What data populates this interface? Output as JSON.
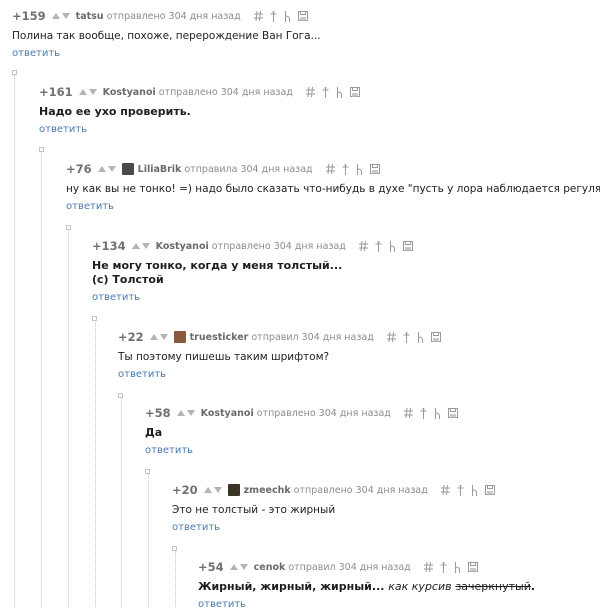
{
  "comments": [
    {
      "rating": "+159",
      "author": "tatsu",
      "meta": "отправлено 304 дня назад",
      "body": "Полина так вообще, похоже, перерождение Ван Гога...",
      "bold": false,
      "avatar": null,
      "reply": "ответить"
    },
    {
      "rating": "+161",
      "author": "Kostyanoi",
      "meta": "отправлено 304 дня назад",
      "body": "Надо ее ухо проверить.",
      "bold": true,
      "avatar": null,
      "reply": "ответить"
    },
    {
      "rating": "+76",
      "author": "LiliaBrik",
      "meta": "отправила 304 дня назад",
      "body": "ну как вы не тонко! =) надо было сказать что-нибудь в духе \"пусть у лора наблюдается регулярно\"",
      "bold": false,
      "avatar": "#4a4a4a",
      "reply": "ответить"
    },
    {
      "rating": "+134",
      "author": "Kostyanoi",
      "meta": "отправлено 304 дня назад",
      "body_lines": [
        "Не могу тонко, когда у меня толстый...",
        "(с) Толстой"
      ],
      "bold": true,
      "avatar": null,
      "reply": "ответить"
    },
    {
      "rating": "+22",
      "author": "truesticker",
      "meta": "отправил 304 дня назад",
      "body": "Ты поэтому пишешь таким шрифтом?",
      "bold": false,
      "avatar": "#8a5a3c",
      "reply": "ответить"
    },
    {
      "rating": "+58",
      "author": "Kostyanoi",
      "meta": "отправлено 304 дня назад",
      "body": "Да",
      "bold": true,
      "avatar": null,
      "reply": "ответить"
    },
    {
      "rating": "+20",
      "author": "zmeechk",
      "meta": "отправлено 304 дня назад",
      "body": "Это не толстый - это жирный",
      "bold": false,
      "avatar": "#3a3424",
      "reply": "ответить"
    },
    {
      "rating": "+54",
      "author": "cenok",
      "meta": "отправил 304 дня назад",
      "body_parts": {
        "bold": "Жирный, жирный, жирный...",
        "italic": "как курсив",
        "strike": "зачеркнутый",
        "end": "."
      },
      "bold": true,
      "avatar": null,
      "reply": "ответить"
    }
  ],
  "header_icons": [
    "hash-icon",
    "pin-icon",
    "branch-icon",
    "save-icon"
  ]
}
